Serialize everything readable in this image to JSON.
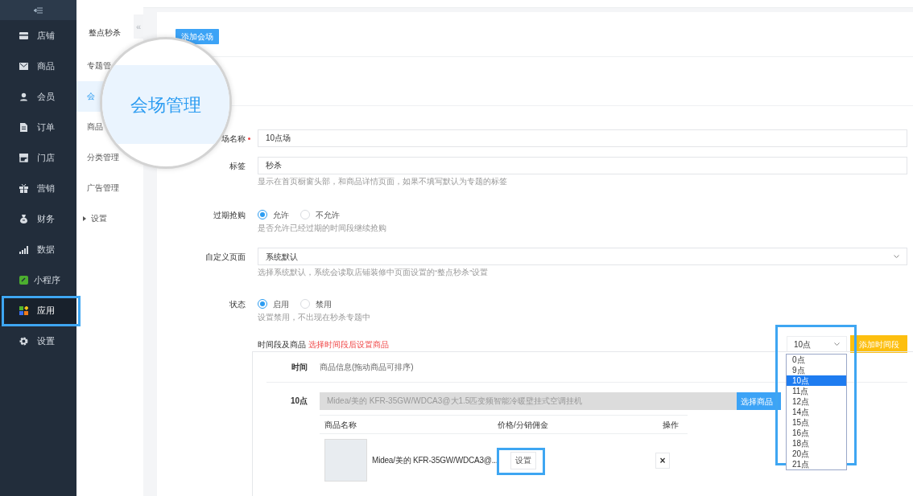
{
  "sidebar": {
    "items": [
      {
        "label": "店铺",
        "selected": false
      },
      {
        "label": "商品",
        "selected": false
      },
      {
        "label": "会员",
        "selected": false
      },
      {
        "label": "订单",
        "selected": false
      },
      {
        "label": "门店",
        "selected": false
      },
      {
        "label": "营销",
        "selected": false
      },
      {
        "label": "财务",
        "selected": false
      },
      {
        "label": "数据",
        "selected": false
      },
      {
        "label": "小程序",
        "selected": false
      },
      {
        "label": "应用",
        "selected": true
      },
      {
        "label": "设置",
        "selected": false
      }
    ]
  },
  "subnav": {
    "title": "整点秒杀",
    "collapse": "«",
    "items": [
      {
        "label": "专题管",
        "selected": false,
        "kind": "link"
      },
      {
        "label": "会",
        "selected": true,
        "kind": "link"
      },
      {
        "label": "商品",
        "selected": false,
        "kind": "link"
      },
      {
        "label": "分类管理",
        "selected": false,
        "kind": "link"
      },
      {
        "label": "广告管理",
        "selected": false,
        "kind": "link"
      },
      {
        "label": "设置",
        "selected": false,
        "kind": "group"
      }
    ]
  },
  "magnifier": {
    "label": "会场管理"
  },
  "add_button": "添加会场",
  "form": {
    "rows": [
      {
        "kind": "input",
        "label": "场名称",
        "required": true,
        "value": "10点场"
      },
      {
        "kind": "input",
        "label": "标签",
        "value": "秒杀",
        "hint": "显示在首页橱窗头部，和商品详情页面，如果不填写默认为专题的标签"
      },
      {
        "kind": "radio",
        "label": "过期抢购",
        "options": [
          {
            "label": "允许",
            "selected": true
          },
          {
            "label": "不允许",
            "selected": false
          }
        ],
        "hint": "是否允许已经过期的时间段继续抢购"
      },
      {
        "kind": "select",
        "label": "自定义页面",
        "value": "系统默认",
        "hint": "选择系统默认，系统会读取店铺装修中页面设置的“整点秒杀”设置"
      },
      {
        "kind": "radio",
        "label": "状态",
        "options": [
          {
            "label": "启用",
            "selected": true
          },
          {
            "label": "禁用",
            "selected": false
          }
        ],
        "hint": "设置禁用，不出现在秒杀专题中"
      }
    ]
  },
  "time_segment": {
    "label": "时间段及商品",
    "note": "选择时间段后设置商品",
    "select_value": "10点",
    "add_button": "添加时间段",
    "options": [
      {
        "label": "0点",
        "selected": false
      },
      {
        "label": "9点",
        "selected": false
      },
      {
        "label": "10点",
        "selected": true
      },
      {
        "label": "11点",
        "selected": false
      },
      {
        "label": "12点",
        "selected": false
      },
      {
        "label": "14点",
        "selected": false
      },
      {
        "label": "15点",
        "selected": false
      },
      {
        "label": "16点",
        "selected": false
      },
      {
        "label": "18点",
        "selected": false
      },
      {
        "label": "20点",
        "selected": false
      },
      {
        "label": "21点",
        "selected": false
      }
    ]
  },
  "segments_table": {
    "columns": [
      "时间",
      "商品信息(拖动商品可排序)"
    ],
    "rows": [
      {
        "time": "10点",
        "product_field": "Midea/美的 KFR-35GW/WDCA3@大1.5匹变频智能冷暖壁挂式空调挂机",
        "select_button": "选择商品",
        "goods": {
          "columns": [
            "商品名称",
            "价格/分销佣金",
            "操作"
          ],
          "rows": [
            {
              "name": "Midea/美的 KFR-35GW/WDCA3@...",
              "set_button": "设置",
              "delete": "×"
            }
          ]
        }
      }
    ]
  }
}
